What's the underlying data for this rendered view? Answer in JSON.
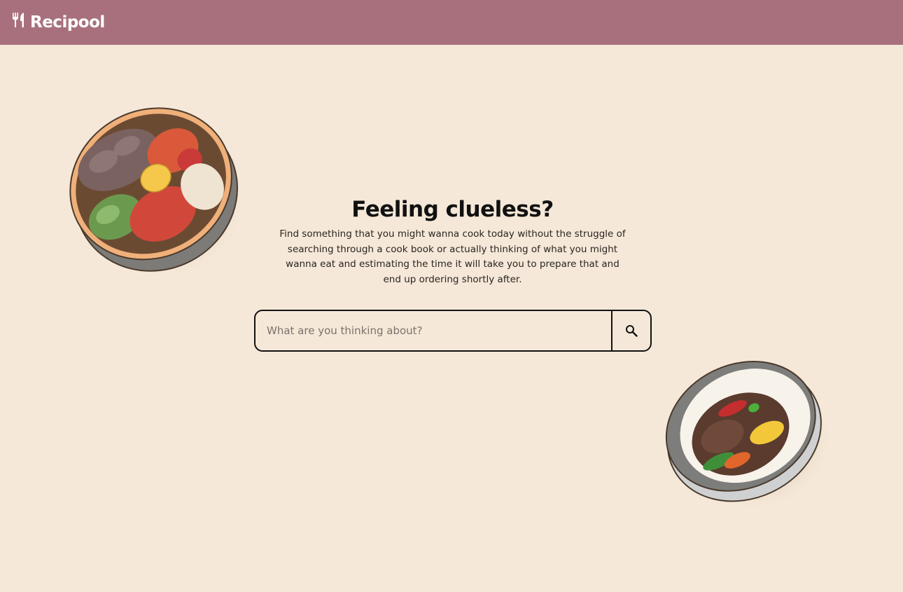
{
  "navbar": {
    "brand_name": "Recipool",
    "brand_icon": "fork-knife-icon",
    "background": "#a8707d"
  },
  "hero": {
    "title": "Feeling clueless?",
    "description": "Find something that you might wanna cook today without the struggle of searching through a cook book or actually thinking of what you might wanna eat and estimating the time it will take you to prepare that and end up ordering shortly after."
  },
  "search": {
    "placeholder": "What are you thinking about?",
    "value": "",
    "button_icon": "search-icon"
  },
  "page": {
    "background": "#f5e8d8"
  }
}
